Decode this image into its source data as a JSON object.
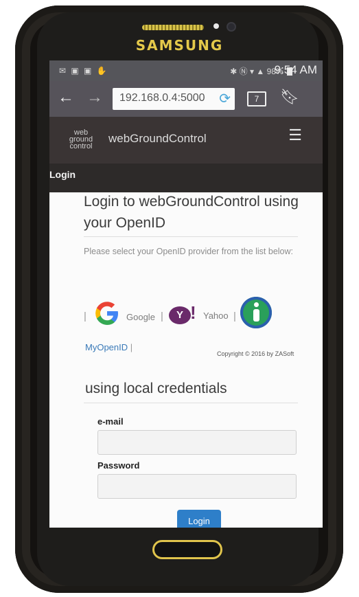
{
  "device": {
    "brand": "SAMSUNG"
  },
  "status_bar": {
    "battery_percent": "98%",
    "time": "9:54 AM"
  },
  "browser": {
    "url": "192.168.0.4:5000",
    "tab_count": "7"
  },
  "site": {
    "logo_lines": [
      "web",
      "ground",
      "control"
    ],
    "title": "webGroundControl",
    "nav_label": "Login"
  },
  "openid": {
    "title": "Login to webGroundControl using your OpenID",
    "description": "Please select your OpenID provider from the list below:",
    "providers": [
      {
        "label": "Google",
        "icon": "google-icon"
      },
      {
        "label": "Yahoo",
        "icon": "yahoo-icon"
      },
      {
        "label": "MyOpenID",
        "icon": "myopenid-icon"
      }
    ],
    "separator": "|",
    "copyright": "Copyright © 2016 by ZASoft"
  },
  "local": {
    "title": "using local credentials",
    "email_label": "e-mail",
    "email_value": "",
    "password_label": "Password",
    "password_value": "",
    "login_label": "Login"
  }
}
